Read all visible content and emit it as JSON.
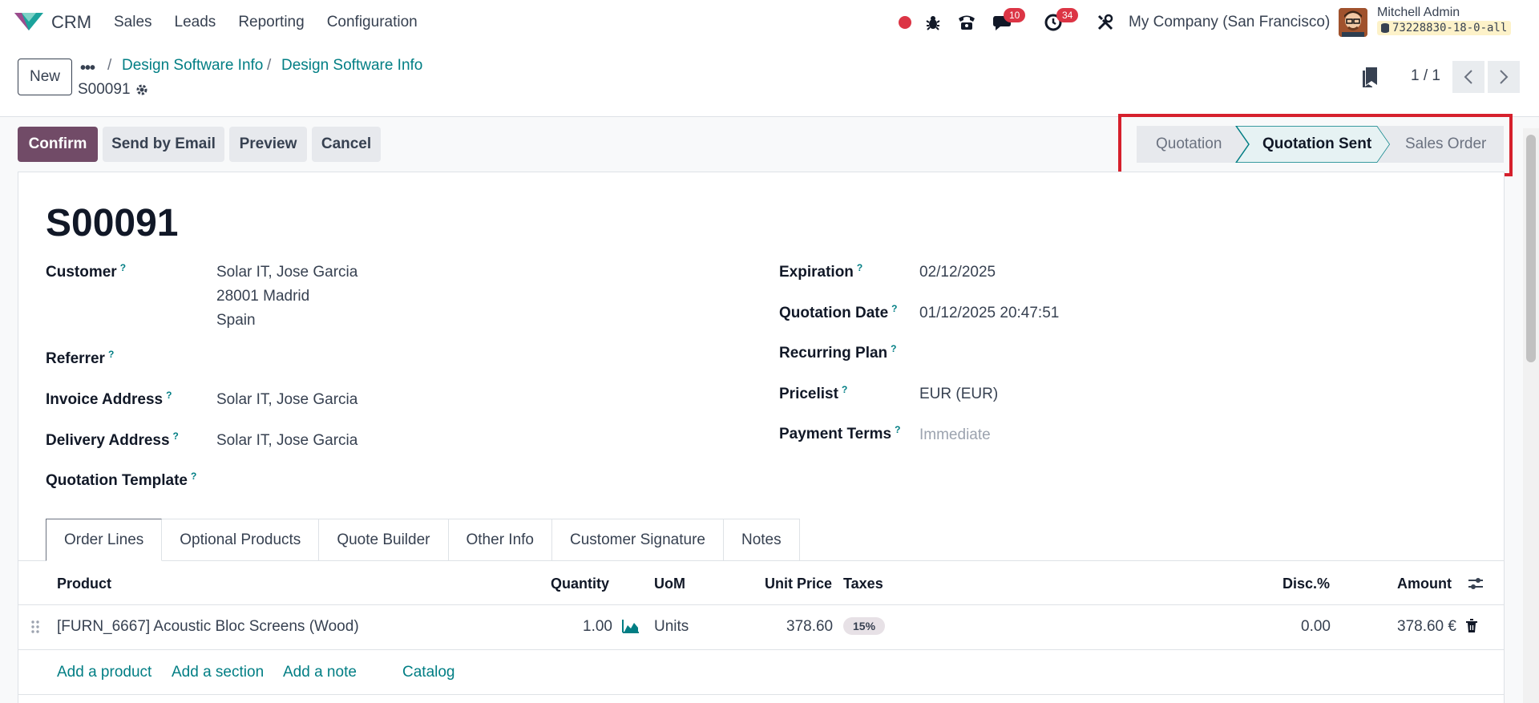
{
  "navbar": {
    "app_name": "CRM",
    "menu": [
      "Sales",
      "Leads",
      "Reporting",
      "Configuration"
    ],
    "messages_count": "10",
    "activities_count": "34",
    "company": "My Company (San Francisco)",
    "user_name": "Mitchell Admin",
    "db_name": "73228830-18-0-all"
  },
  "control_panel": {
    "new_label": "New",
    "breadcrumbs": [
      "Design Software Info",
      "Design Software Info"
    ],
    "record_name": "S00091",
    "pager": "1 / 1"
  },
  "actions": {
    "confirm": "Confirm",
    "send_email": "Send by Email",
    "preview": "Preview",
    "cancel": "Cancel"
  },
  "status": {
    "stages": [
      "Quotation",
      "Quotation Sent",
      "Sales Order"
    ],
    "current": "Quotation Sent"
  },
  "form": {
    "title": "S00091",
    "customer_label": "Customer",
    "customer_lines": [
      "Solar IT, Jose Garcia",
      "28001 Madrid",
      "Spain"
    ],
    "referrer_label": "Referrer",
    "invoice_address_label": "Invoice Address",
    "invoice_address": "Solar IT, Jose Garcia",
    "delivery_address_label": "Delivery Address",
    "delivery_address": "Solar IT, Jose Garcia",
    "quotation_template_label": "Quotation Template",
    "expiration_label": "Expiration",
    "expiration": "02/12/2025",
    "quotation_date_label": "Quotation Date",
    "quotation_date": "01/12/2025 20:47:51",
    "recurring_plan_label": "Recurring Plan",
    "pricelist_label": "Pricelist",
    "pricelist": "EUR (EUR)",
    "payment_terms_label": "Payment Terms",
    "payment_terms_placeholder": "Immediate"
  },
  "tabs": [
    "Order Lines",
    "Optional Products",
    "Quote Builder",
    "Other Info",
    "Customer Signature",
    "Notes"
  ],
  "order_lines": {
    "columns": {
      "product": "Product",
      "quantity": "Quantity",
      "uom": "UoM",
      "unit_price": "Unit Price",
      "taxes": "Taxes",
      "discount": "Disc.%",
      "amount": "Amount"
    },
    "rows": [
      {
        "product": "[FURN_6667] Acoustic Bloc Screens (Wood)",
        "quantity": "1.00",
        "uom": "Units",
        "unit_price": "378.60",
        "taxes": "15%",
        "discount": "0.00",
        "amount": "378.60 €"
      }
    ],
    "add_product": "Add a product",
    "add_section": "Add a section",
    "add_note": "Add a note",
    "catalog": "Catalog"
  },
  "colors": {
    "primary": "#714b67",
    "link": "#017e84",
    "highlight": "#d6202c",
    "badge": "#dc3545"
  }
}
